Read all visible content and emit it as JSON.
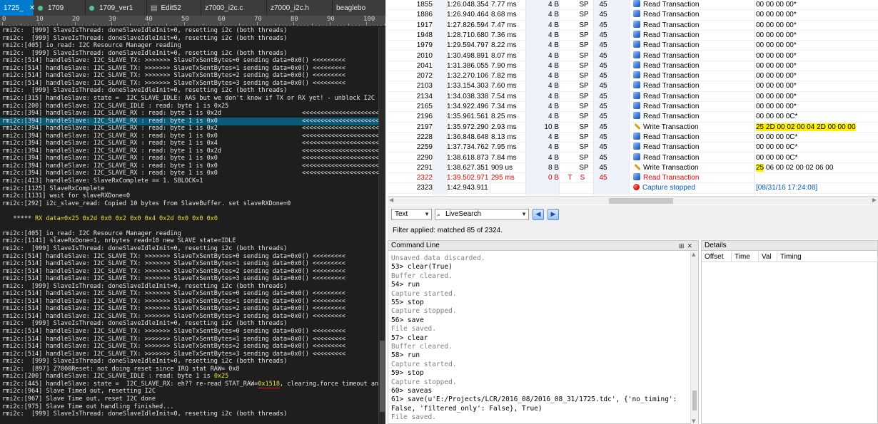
{
  "editor": {
    "tabs": [
      {
        "label": "1725_",
        "active": true,
        "dot": false
      },
      {
        "label": "1709",
        "active": false,
        "dot": true
      },
      {
        "label": "1709_ver1",
        "active": false,
        "dot": true
      },
      {
        "label": "Edit52",
        "active": false,
        "dot": false,
        "icon": "document-icon"
      },
      {
        "label": "z7000_i2c.c",
        "active": false,
        "dot": false
      },
      {
        "label": "z7000_i2c.h",
        "active": false,
        "dot": false
      },
      {
        "label": "beaglebo",
        "active": false,
        "dot": false
      }
    ],
    "ruler_labels": [
      "0",
      "10",
      "20",
      "30",
      "40",
      "50",
      "60",
      "70",
      "80",
      "90",
      "100",
      "110"
    ],
    "lines": [
      {
        "t": "rmi2c:  [999] SlaveIsThread: doneSlaveIdleInit=0, resetting i2c (both threads)"
      },
      {
        "t": "rmi2c:  [999] SlaveIsThread: doneSlaveIdleInit=0, resetting i2c (both threads)"
      },
      {
        "t": "rmi2c:[405] io_read: I2C Resource Manager reading"
      },
      {
        "t": "rmi2c:  [999] SlaveIsThread: doneSlaveIdleInit=0, resetting i2c (both threads)"
      },
      {
        "t": "rmi2c:[514] handleSlave: I2C_SLAVE_TX: >>>>>>> SlaveTxSentBytes=0 sending data=0x0() <<<<<<<<<"
      },
      {
        "t": "rmi2c:[514] handleSlave: I2C_SLAVE_TX: >>>>>>> SlaveTxSentBytes=1 sending data=0x0() <<<<<<<<<"
      },
      {
        "t": "rmi2c:[514] handleSlave: I2C_SLAVE_TX: >>>>>>> SlaveTxSentBytes=2 sending data=0x0() <<<<<<<<<"
      },
      {
        "t": "rmi2c:[514] handleSlave: I2C_SLAVE_TX: >>>>>>> SlaveTxSentBytes=3 sending data=0x0() <<<<<<<<<"
      },
      {
        "t": "rmi2c:  [999] SlaveIsThread: doneSlaveIdleInit=0, resetting i2c (both threads)"
      },
      {
        "t": "rmi2c:[315] handleSlave: state =  I2C_SLAVE_IDLE: AAS but we don't know if TX or RX yet! - unblock I2C"
      },
      {
        "t": "rmi2c:[200] handleSlave: I2C_SLAVE_IDLE : read: byte 1 is 0x25"
      },
      {
        "t": "rmi2c:[394] handleSlave: I2C_SLAVE_RX : read: byte 1 is 0x2d",
        "arr": "<<<<<<<<<<<<<<<<<<<<<<<<<<<<<"
      },
      {
        "t": "rmi2c:[394] handleSlave: I2C_SLAVE_RX : read: byte 1 is 0x0",
        "arr": "<<<<<<<<<<<<<<<<<<<<<<<<<<<<<",
        "sel": true
      },
      {
        "t": "rmi2c:[394] handleSlave: I2C_SLAVE_RX : read: byte 1 is 0x2",
        "arr": "<<<<<<<<<<<<<<<<<<<<<<<<<<<<<"
      },
      {
        "t": "rmi2c:[394] handleSlave: I2C_SLAVE_RX : read: byte 1 is 0x0",
        "arr": "<<<<<<<<<<<<<<<<<<<<<<<<<<<<<"
      },
      {
        "t": "rmi2c:[394] handleSlave: I2C_SLAVE_RX : read: byte 1 is 0x4",
        "arr": "<<<<<<<<<<<<<<<<<<<<<<<<<<<<<"
      },
      {
        "t": "rmi2c:[394] handleSlave: I2C_SLAVE_RX : read: byte 1 is 0x2d",
        "arr": "<<<<<<<<<<<<<<<<<<<<<<<<<<<<<"
      },
      {
        "t": "rmi2c:[394] handleSlave: I2C_SLAVE_RX : read: byte 1 is 0x0",
        "arr": "<<<<<<<<<<<<<<<<<<<<<<<<<<<<<"
      },
      {
        "t": "rmi2c:[394] handleSlave: I2C_SLAVE_RX : read: byte 1 is 0x0",
        "arr": "<<<<<<<<<<<<<<<<<<<<<<<<<<<<<"
      },
      {
        "t": "rmi2c:[394] handleSlave: I2C_SLAVE_RX : read: byte 1 is 0x0",
        "arr": "<<<<<<<<<<<<<<<<<<<<<<<<<<<<<"
      },
      {
        "t": "rmi2c:[413] handleSlave: SlaveRxComplete == 1. SBLOCK=1"
      },
      {
        "t": "rmi2c:[1125] SlaveRxComplete"
      },
      {
        "t": "rmi2c:[1131] wait for slaveRXDone=0"
      },
      {
        "t": "rmi2c:[292] i2c_slave_read: Copied 10 bytes from SlaveBuffer. set slaveRXDone=0"
      },
      {
        "t": ""
      },
      {
        "t": "   ***** ",
        "hl": "RX data=0x25 0x2d 0x0 0x2 0x0 0x4 0x2d 0x0 0x0 0x0"
      },
      {
        "t": ""
      },
      {
        "t": "rmi2c:[405] io_read: I2C Resource Manager reading"
      },
      {
        "t": "rmi2c:[1141] slaveRxDone=1, nrbytes read=10 new SLAVE state=IDLE"
      },
      {
        "t": "rmi2c:  [999] SlaveIsThread: doneSlaveIdleInit=0, resetting i2c (both threads)"
      },
      {
        "t": "rmi2c:[514] handleSlave: I2C_SLAVE_TX: >>>>>>> SlaveTxSentBytes=0 sending data=0x0() <<<<<<<<<"
      },
      {
        "t": "rmi2c:[514] handleSlave: I2C_SLAVE_TX: >>>>>>> SlaveTxSentBytes=1 sending data=0x0() <<<<<<<<<"
      },
      {
        "t": "rmi2c:[514] handleSlave: I2C_SLAVE_TX: >>>>>>> SlaveTxSentBytes=2 sending data=0x0() <<<<<<<<<"
      },
      {
        "t": "rmi2c:[514] handleSlave: I2C_SLAVE_TX: >>>>>>> SlaveTxSentBytes=3 sending data=0x0() <<<<<<<<<"
      },
      {
        "t": "rmi2c:  [999] SlaveIsThread: doneSlaveIdleInit=0, resetting i2c (both threads)"
      },
      {
        "t": "rmi2c:[514] handleSlave: I2C_SLAVE_TX: >>>>>>> SlaveTxSentBytes=0 sending data=0x0() <<<<<<<<<"
      },
      {
        "t": "rmi2c:[514] handleSlave: I2C_SLAVE_TX: >>>>>>> SlaveTxSentBytes=1 sending data=0x0() <<<<<<<<<"
      },
      {
        "t": "rmi2c:[514] handleSlave: I2C_SLAVE_TX: >>>>>>> SlaveTxSentBytes=2 sending data=0x0() <<<<<<<<<"
      },
      {
        "t": "rmi2c:[514] handleSlave: I2C_SLAVE_TX: >>>>>>> SlaveTxSentBytes=3 sending data=0x0() <<<<<<<<<"
      },
      {
        "t": "rmi2c:  [999] SlaveIsThread: doneSlaveIdleInit=0, resetting i2c (both threads)"
      },
      {
        "t": "rmi2c:[514] handleSlave: I2C_SLAVE_TX: >>>>>>> SlaveTxSentBytes=0 sending data=0x0() <<<<<<<<<"
      },
      {
        "t": "rmi2c:[514] handleSlave: I2C_SLAVE_TX: >>>>>>> SlaveTxSentBytes=1 sending data=0x0() <<<<<<<<<"
      },
      {
        "t": "rmi2c:[514] handleSlave: I2C_SLAVE_TX: >>>>>>> SlaveTxSentBytes=2 sending data=0x0() <<<<<<<<<"
      },
      {
        "t": "rmi2c:[514] handleSlave: I2C_SLAVE_TX: >>>>>>> SlaveTxSentBytes=3 sending data=0x0() <<<<<<<<<"
      },
      {
        "t": "rmi2c:  [999] SlaveIsThread: doneSlaveIdleInit=0, resetting i2c (both threads)"
      },
      {
        "t": "rmi2c:  [897] Z7000Reset: not doing reset since IRQ stat RAW= 0x8"
      },
      {
        "t": "rmi2c:[200] handleSlave: I2C_SLAVE_IDLE : read: byte 1 is ",
        "hl": "0x25"
      },
      {
        "t": "rmi2c:[445] handleSlave: state =  I2C_SLAVE_RX: eh?? re-read STAT_RAW=",
        "hl": "0x1518",
        "ul": true,
        "tail": ", clearing,force timeout and idle"
      },
      {
        "t": "rmi2c:[964] Slave Timed out, resetting I2C"
      },
      {
        "t": "rmi2c:[967] Slave Time out, reset I2C done"
      },
      {
        "t": "rmi2c:[975] Slave Time out handling finished..."
      },
      {
        "t": "rmi2c:  [999] SlaveIsThread: doneSlaveIdleInit=0, resetting i2c (both threads)"
      }
    ]
  },
  "transactions": [
    {
      "idx": "1855",
      "time": "1:26.048.354",
      "dur": "7.77 ms",
      "len": "4 B",
      "err": "",
      "rec": "",
      "spd": "SP",
      "addr": "45",
      "kind": "read",
      "desc": "Read Transaction",
      "data": "00 00 00 00*"
    },
    {
      "idx": "1886",
      "time": "1:26.940.464",
      "dur": "8.68 ms",
      "len": "4 B",
      "err": "",
      "rec": "",
      "spd": "SP",
      "addr": "45",
      "kind": "read",
      "desc": "Read Transaction",
      "data": "00 00 00 00*"
    },
    {
      "idx": "1917",
      "time": "1:27.826.594",
      "dur": "7.47 ms",
      "len": "4 B",
      "err": "",
      "rec": "",
      "spd": "SP",
      "addr": "45",
      "kind": "read",
      "desc": "Read Transaction",
      "data": "00 00 00 00*"
    },
    {
      "idx": "1948",
      "time": "1:28.710.680",
      "dur": "7.36 ms",
      "len": "4 B",
      "err": "",
      "rec": "",
      "spd": "SP",
      "addr": "45",
      "kind": "read",
      "desc": "Read Transaction",
      "data": "00 00 00 00*"
    },
    {
      "idx": "1979",
      "time": "1:29.594.797",
      "dur": "8.22 ms",
      "len": "4 B",
      "err": "",
      "rec": "",
      "spd": "SP",
      "addr": "45",
      "kind": "read",
      "desc": "Read Transaction",
      "data": "00 00 00 00*"
    },
    {
      "idx": "2010",
      "time": "1:30.498.891",
      "dur": "8.07 ms",
      "len": "4 B",
      "err": "",
      "rec": "",
      "spd": "SP",
      "addr": "45",
      "kind": "read",
      "desc": "Read Transaction",
      "data": "00 00 00 00*"
    },
    {
      "idx": "2041",
      "time": "1:31.386.055",
      "dur": "7.90 ms",
      "len": "4 B",
      "err": "",
      "rec": "",
      "spd": "SP",
      "addr": "45",
      "kind": "read",
      "desc": "Read Transaction",
      "data": "00 00 00 00*"
    },
    {
      "idx": "2072",
      "time": "1:32.270.106",
      "dur": "7.82 ms",
      "len": "4 B",
      "err": "",
      "rec": "",
      "spd": "SP",
      "addr": "45",
      "kind": "read",
      "desc": "Read Transaction",
      "data": "00 00 00 00*"
    },
    {
      "idx": "2103",
      "time": "1:33.154.303",
      "dur": "7.60 ms",
      "len": "4 B",
      "err": "",
      "rec": "",
      "spd": "SP",
      "addr": "45",
      "kind": "read",
      "desc": "Read Transaction",
      "data": "00 00 00 00*"
    },
    {
      "idx": "2134",
      "time": "1:34.038.338",
      "dur": "7.54 ms",
      "len": "4 B",
      "err": "",
      "rec": "",
      "spd": "SP",
      "addr": "45",
      "kind": "read",
      "desc": "Read Transaction",
      "data": "00 00 00 00*"
    },
    {
      "idx": "2165",
      "time": "1:34.922.496",
      "dur": "7.34 ms",
      "len": "4 B",
      "err": "",
      "rec": "",
      "spd": "SP",
      "addr": "45",
      "kind": "read",
      "desc": "Read Transaction",
      "data": "00 00 00 00*"
    },
    {
      "idx": "2196",
      "time": "1:35.961.561",
      "dur": "8.25 ms",
      "len": "4 B",
      "err": "",
      "rec": "",
      "spd": "SP",
      "addr": "45",
      "kind": "read",
      "desc": "Read Transaction",
      "data": "00 00 00 0C*"
    },
    {
      "idx": "2197",
      "time": "1:35.972.290",
      "dur": "2.93 ms",
      "len": "10 B",
      "err": "",
      "rec": "",
      "spd": "SP",
      "addr": "45",
      "kind": "write",
      "desc": "Write Transaction",
      "data": "25 2D 00 02 00 04 2D 00 00 00",
      "mark": "all"
    },
    {
      "idx": "2228",
      "time": "1:36.848.648",
      "dur": "8.13 ms",
      "len": "4 B",
      "err": "",
      "rec": "",
      "spd": "SP",
      "addr": "45",
      "kind": "read",
      "desc": "Read Transaction",
      "data": "00 00 00 0C*"
    },
    {
      "idx": "2259",
      "time": "1:37.734.762",
      "dur": "7.95 ms",
      "len": "4 B",
      "err": "",
      "rec": "",
      "spd": "SP",
      "addr": "45",
      "kind": "read",
      "desc": "Read Transaction",
      "data": "00 00 00 0C*"
    },
    {
      "idx": "2290",
      "time": "1:38.618.873",
      "dur": "7.84 ms",
      "len": "4 B",
      "err": "",
      "rec": "",
      "spd": "SP",
      "addr": "45",
      "kind": "read",
      "desc": "Read Transaction",
      "data": "00 00 00 0C*"
    },
    {
      "idx": "2291",
      "time": "1:38.627.351",
      "dur": "909 us",
      "len": "8 B",
      "err": "",
      "rec": "",
      "spd": "SP",
      "addr": "45",
      "kind": "write",
      "desc": "Write Transaction",
      "data": "25 06 00 02 00 02 06 00",
      "mark": "first"
    },
    {
      "idx": "2322",
      "time": "1:39.502.971",
      "dur": "295 ms",
      "len": "0 B",
      "err": "T",
      "rec": "S",
      "spd": "",
      "addr": "45",
      "kind": "read",
      "desc": "Read Transaction",
      "data": "",
      "red": true
    },
    {
      "idx": "2323",
      "time": "1:42.943.911",
      "dur": "",
      "len": "",
      "err": "",
      "rec": "",
      "spd": "",
      "addr": "",
      "kind": "stop",
      "desc": "Capture stopped",
      "data": "[08/31/16 17:24:08]"
    }
  ],
  "filter": {
    "mode": "Text",
    "search_mode": "LiveSearch",
    "message": "Filter applied: matched 85 of 2324."
  },
  "command_line": {
    "title": "Command Line",
    "lines": [
      {
        "t": "Unsaved data discarded.",
        "k": "out"
      },
      {
        "t": "53> clear(True)",
        "k": "in"
      },
      {
        "t": "Buffer cleared.",
        "k": "out"
      },
      {
        "t": "54> run",
        "k": "in"
      },
      {
        "t": "Capture started.",
        "k": "out"
      },
      {
        "t": "55> stop",
        "k": "in"
      },
      {
        "t": "Capture stopped.",
        "k": "out"
      },
      {
        "t": "56> save",
        "k": "in"
      },
      {
        "t": "File saved.",
        "k": "out"
      },
      {
        "t": "57> clear",
        "k": "in"
      },
      {
        "t": "Buffer cleared.",
        "k": "out"
      },
      {
        "t": "58> run",
        "k": "in"
      },
      {
        "t": "Capture started.",
        "k": "out"
      },
      {
        "t": "59> stop",
        "k": "in"
      },
      {
        "t": "Capture stopped.",
        "k": "out"
      },
      {
        "t": "60> saveas",
        "k": "in"
      },
      {
        "t": "61> save(u'E:/Projects/LCR/2016_08/2016_08_31/1725.tdc', {'no_timing':",
        "k": "in"
      },
      {
        "t": "False, 'filtered_only': False}, True)",
        "k": "in"
      },
      {
        "t": "File saved.",
        "k": "out"
      }
    ]
  },
  "details": {
    "title": "Details",
    "columns": [
      "Offset",
      "Time",
      "Val",
      "Timing"
    ]
  }
}
